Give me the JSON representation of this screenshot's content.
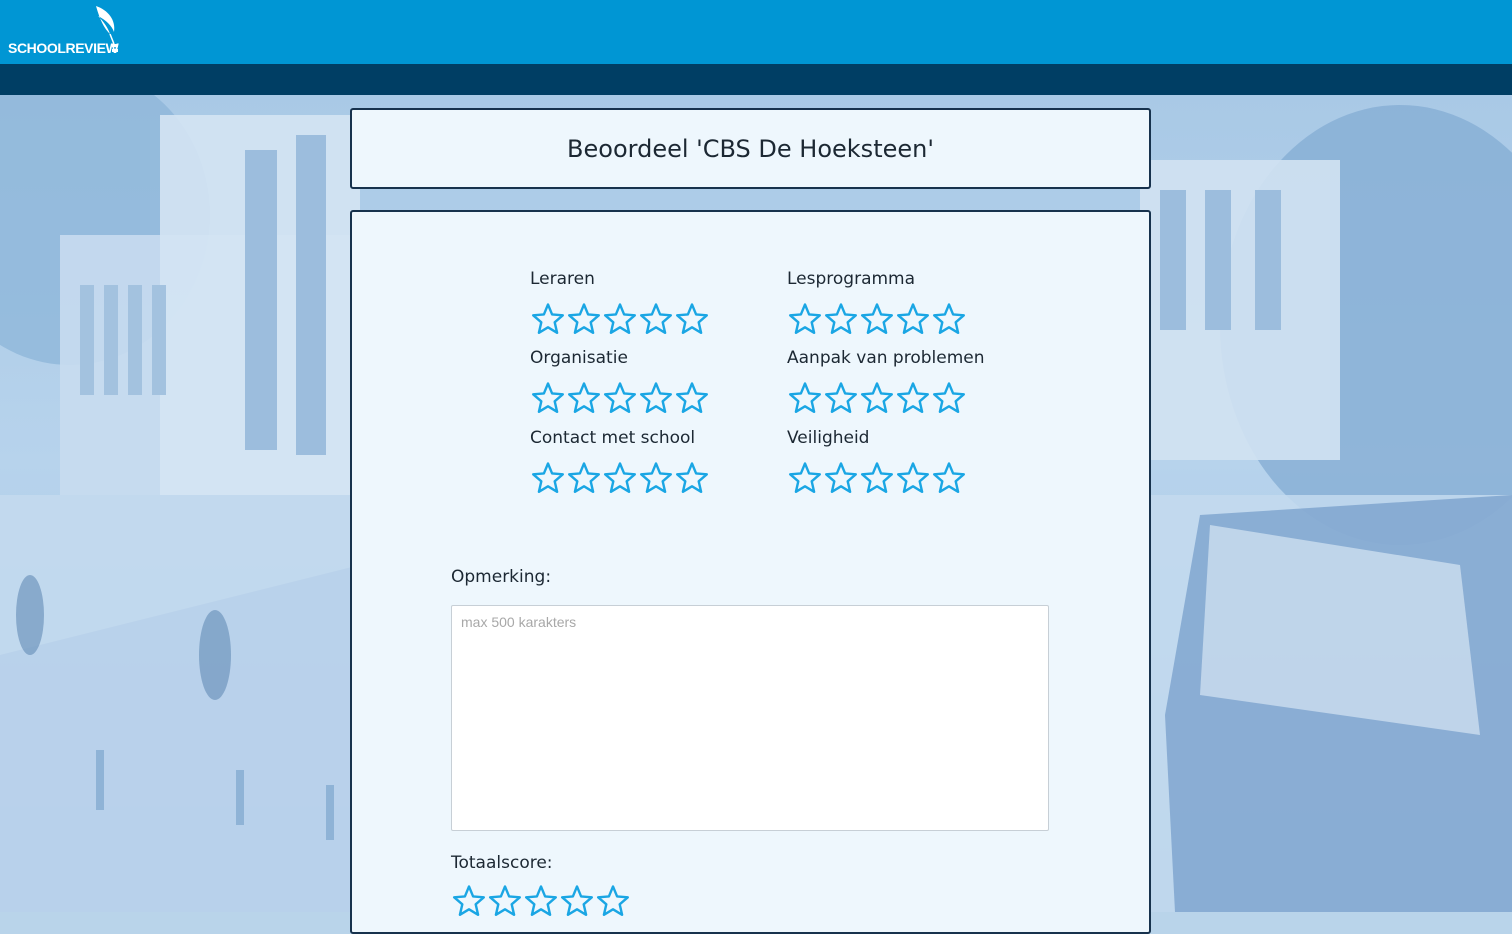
{
  "header": {
    "logo_text": "SCHOOLREVIEW",
    "brand_color": "#0096d4",
    "subbar_color": "#003e64"
  },
  "review": {
    "title": "Beoordeel 'CBS De Hoeksteen'",
    "criteria": [
      {
        "label": "Leraren",
        "rating": 0,
        "max": 5
      },
      {
        "label": "Lesprogramma",
        "rating": 0,
        "max": 5
      },
      {
        "label": "Organisatie",
        "rating": 0,
        "max": 5
      },
      {
        "label": "Aanpak van problemen",
        "rating": 0,
        "max": 5
      },
      {
        "label": "Contact met school",
        "rating": 0,
        "max": 5
      },
      {
        "label": "Veiligheid",
        "rating": 0,
        "max": 5
      }
    ],
    "remark_label": "Opmerking:",
    "remark_placeholder": "max 500 karakters",
    "remark_value": "",
    "total_label": "Totaalscore:",
    "total_rating": 0,
    "star_color": "#1aa6e4",
    "star_icon": "star-outline-icon"
  }
}
